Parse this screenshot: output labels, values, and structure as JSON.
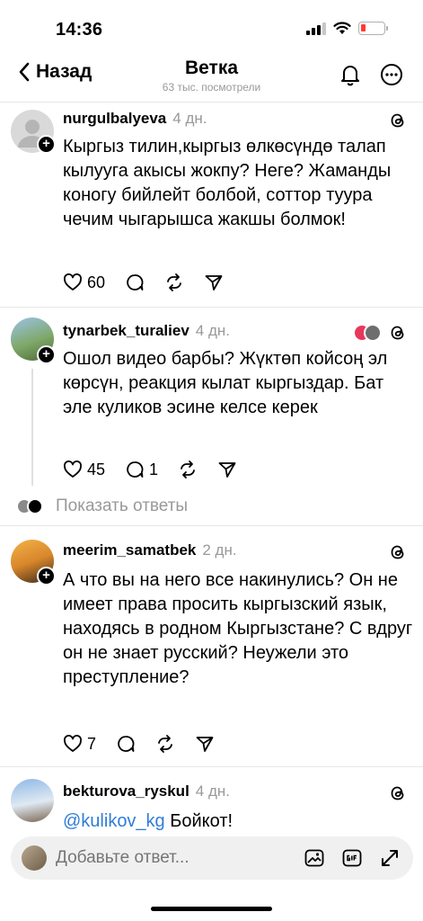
{
  "status_bar": {
    "time": "14:36"
  },
  "nav": {
    "back_label": "Назад",
    "title": "Ветка",
    "subtitle": "63 тыс. посмотрели"
  },
  "posts": [
    {
      "username": "nurgulbalyeva",
      "time": "4 дн.",
      "text": "Кыргыз тилин,кыргыз өлкөсүндө талап кылууга акысы жокпу? Неге? Жаманды коногу бийлейт болбой, соттор туура чечим чыгарышса жакшы болмок!",
      "likes": "60"
    },
    {
      "username": "tynarbek_turaliev",
      "time": "4 дн.",
      "text": "Ошол видео барбы?  Жүктөп койсоң эл көрсүн, реакция кылат кыргыздар. Бат эле куликов эсине келсе керек",
      "likes": "45",
      "replies": "1"
    },
    {
      "username": "meerim_samatbek",
      "time": "2 дн.",
      "text": "А что вы на него все накинулись? Он не имеет права просить кыргызский язык, находясь в родном Кыргызстане? С вдруг он не знает русский? Неужели это преступление?",
      "likes": "7"
    },
    {
      "username": "bekturova_ryskul",
      "time": "4 дн.",
      "mention": "@kulikov_kg",
      "text": "Бойкот!"
    }
  ],
  "show_replies_label": "Показать ответы",
  "reply_bar": {
    "placeholder": "Добавьте ответ..."
  },
  "colors": {
    "mention": "#2f7dd6",
    "muted": "#999999",
    "battery_low": "#ff3b30"
  }
}
